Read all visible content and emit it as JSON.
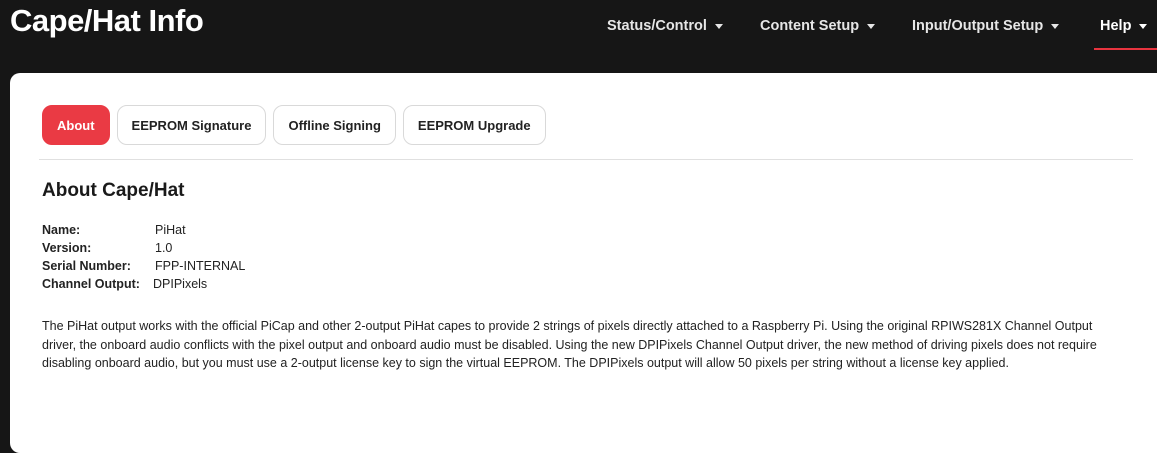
{
  "header": {
    "title": "Cape/Hat Info",
    "nav": [
      {
        "label": "Status/Control"
      },
      {
        "label": "Content Setup"
      },
      {
        "label": "Input/Output Setup"
      },
      {
        "label": "Help"
      }
    ],
    "active_nav": "Help"
  },
  "tabs": [
    {
      "label": "About",
      "active": true
    },
    {
      "label": "EEPROM Signature",
      "active": false
    },
    {
      "label": "Offline Signing",
      "active": false
    },
    {
      "label": "EEPROM Upgrade",
      "active": false
    }
  ],
  "about": {
    "title": "About Cape/Hat",
    "fields": [
      {
        "label": "Name:",
        "value": "PiHat"
      },
      {
        "label": "Version:",
        "value": "1.0"
      },
      {
        "label": "Serial Number:",
        "value": "FPP-INTERNAL"
      },
      {
        "label": "Channel Output:",
        "value": "DPIPixels"
      }
    ],
    "description": "The PiHat output works with the official PiCap and other 2-output PiHat capes to provide 2 strings of pixels directly attached to a Raspberry Pi. Using the original RPIWS281X Channel Output driver, the onboard audio conflicts with the pixel output and onboard audio must be disabled. Using the new DPIPixels Channel Output driver, the new method of driving pixels does not require disabling onboard audio, but you must use a 2-output license key to sign the virtual EEPROM. The DPIPixels output will allow 50 pixels per string without a license key applied."
  },
  "colors": {
    "accent": "#ea3a44",
    "header_bg": "#161616",
    "card_bg": "#ffffff"
  }
}
